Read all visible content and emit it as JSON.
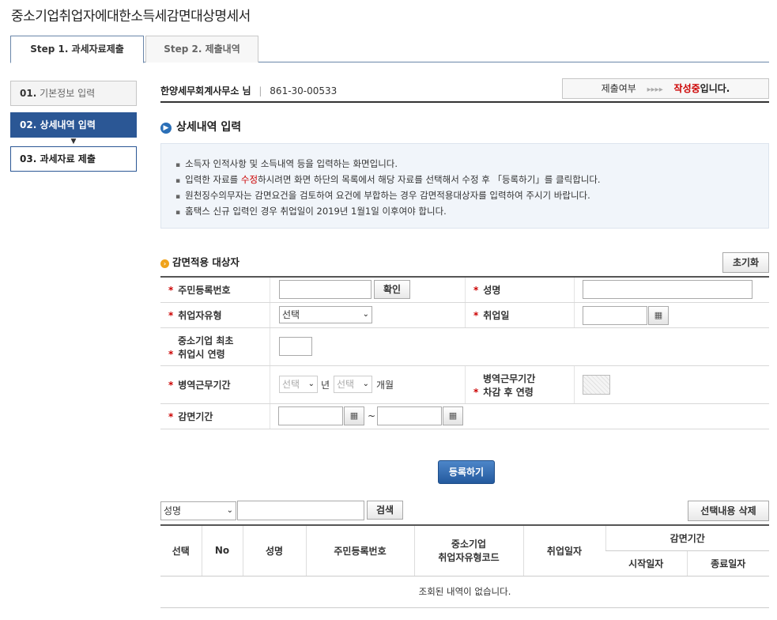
{
  "page_title": "중소기업취업자에대한소득세감면대상명세서",
  "tabs": [
    {
      "label": "Step 1. 과세자료제출"
    },
    {
      "label": "Step 2. 제출내역"
    }
  ],
  "sidenav": [
    {
      "num": "01.",
      "label": "기본정보 입력"
    },
    {
      "num": "02.",
      "label": "상세내역 입력"
    },
    {
      "num": "03.",
      "label": "과세자료 제출"
    }
  ],
  "org": {
    "name": "한양세무회계사무소 님",
    "separator": "|",
    "bizno": "861-30-00533"
  },
  "status": {
    "label": "제출여부",
    "arrows": "▸▸▸▸",
    "state": "작성중",
    "suffix": "입니다."
  },
  "section_title": "상세내역 입력",
  "notice": {
    "line1": "소득자 인적사항 및 소득내역 등을 입력하는 화면입니다.",
    "line2_a": "입력한 자료를 ",
    "line2_red": "수정",
    "line2_b": "하시려면 화면 하단의 목록에서 해당 자료를 선택해서 수정 후 「등록하기」를 클릭합니다.",
    "line3": "원천징수의무자는 감면요건을 검토하여 요건에 부합하는 경우 감면적용대상자를 입력하여 주시기 바랍니다.",
    "line4": "홈택스 신규 입력인 경우 취업일이 2019년 1월1일 이후여야 합니다."
  },
  "subsection_title": "감면적용 대상자",
  "reset_label": "초기화",
  "form": {
    "req_mark": "*",
    "resident_no_label": "주민등록번호",
    "resident_no_value": "",
    "confirm_label": "확인",
    "name_label": "성명",
    "name_value": "",
    "emp_type_label": "취업자유형",
    "emp_type_value": "선택",
    "emp_date_label": "취업일",
    "emp_date_value": "",
    "first_age_label_1": "중소기업 최초",
    "first_age_label_2": "취업시 연령",
    "first_age_value": "",
    "military_label": "병역근무기간",
    "military_year_value": "선택",
    "year_unit": "년",
    "military_month_value": "선택",
    "month_unit": "개월",
    "age_after_label_1": "병역근무기간",
    "age_after_label_2": "차감 후 연령",
    "reduce_period_label": "감면기간",
    "reduce_from_value": "",
    "tilde": "~",
    "reduce_to_value": "",
    "calendar_glyph": "▦"
  },
  "register_label": "등록하기",
  "search": {
    "field_value": "성명",
    "keyword_value": "",
    "search_label": "검색",
    "delete_label": "선택내용 삭제"
  },
  "table": {
    "headers": {
      "select": "선택",
      "no": "No",
      "name": "성명",
      "resident_no": "주민등록번호",
      "code_1": "중소기업",
      "code_2": "취업자유형코드",
      "emp_date": "취업일자",
      "period": "감면기간",
      "start": "시작일자",
      "end": "종료일자"
    },
    "empty_message": "조회된 내역이 없습니다."
  },
  "colors": {
    "accent": "#2b5795",
    "required": "#cc0000",
    "status": "#cc0000"
  }
}
